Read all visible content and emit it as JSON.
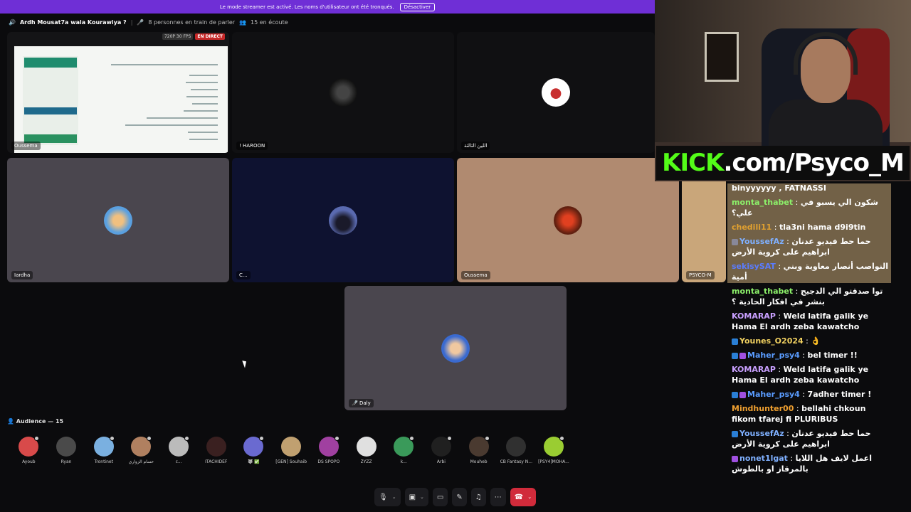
{
  "banner": {
    "text": "Le mode streamer est activé. Les noms d'utilisateur ont été tronqués.",
    "button": "Désactiver"
  },
  "header": {
    "channel": "Ardh Mousat7a wala Kourawiya ?",
    "speaking": "8 personnes en train de parler",
    "listening": "15 en écoute"
  },
  "share": {
    "name": "Oussema",
    "resolution": "720P 30 FPS",
    "live": "EN DIRECT"
  },
  "tiles": {
    "haroon": "! HAROON",
    "arabic1": "اللين الثالثة",
    "iardha": "Iardha",
    "c": "C...",
    "oussema": "Oussema",
    "psyco": "PSYCO-M",
    "daly": "Daly"
  },
  "kick": {
    "brand": "KICK",
    "rest": ".com/Psyco_M"
  },
  "chat": [
    {
      "user": "",
      "text": "binyyyyyy , FATNASSI",
      "color": "#fff",
      "rtl": false
    },
    {
      "user": "monta_thabet",
      "text": "شكون الي يسبو في علي؟",
      "color": "#8cf06a",
      "rtl": false
    },
    {
      "user": "chedili11",
      "text": "tla3ni hama d9i9tin",
      "color": "#e0a030",
      "rtl": false
    },
    {
      "user": "YoussefAz",
      "text": "حما حط فيديو عدنان ابراهيم على كروية الأرض",
      "color": "#7fb0ff",
      "rtl": false,
      "badge": "#889"
    },
    {
      "user": "sekisySAT",
      "text": "النواصب أنصار معاوية وبني أمية",
      "color": "#5a7cff",
      "rtl": false
    },
    {
      "user": "monta_thabet",
      "text": "توا صدقتو الي الدجيج بنشر في افكار الحادية ؟",
      "color": "#8cf06a",
      "rtl": false
    },
    {
      "user": "KOMARAP",
      "text": "Weld latifa galik ye Hama El ardh zeba kawatcho",
      "color": "#c9a0ff",
      "rtl": false
    },
    {
      "user": "Younes_O2024",
      "text": "👌",
      "color": "#f0d060",
      "rtl": false,
      "badge": "#2a7fd6"
    },
    {
      "user": "Maher_psy4",
      "text": "bel timer !!",
      "color": "#5a9cff",
      "rtl": false,
      "badge": "#2a7fd6",
      "badge2": "#a050e0"
    },
    {
      "user": "KOMARAP",
      "text": "Weld latifa galik ye Hama El ardh zeba kawatcho",
      "color": "#c9a0ff",
      "rtl": false
    },
    {
      "user": "Maher_psy4",
      "text": "7adher timer !",
      "color": "#5a9cff",
      "rtl": false,
      "badge": "#2a7fd6",
      "badge2": "#a050e0"
    },
    {
      "user": "Mindhunter00",
      "text": "bellahi chkoun fikom tfarej fi PLURIBUS",
      "color": "#f0a030",
      "rtl": false
    },
    {
      "user": "YoussefAz",
      "text": "حما حط فيديو عدنان ابراهيم على كروية الأرض",
      "color": "#7fb0ff",
      "rtl": false,
      "badge": "#2a7fd6"
    },
    {
      "user": "nonet1lgat",
      "text": "اعمل لايف هل اللايا بالمرقاز او بالطوش",
      "color": "#7fb0ff",
      "rtl": false,
      "badge": "#a050e0"
    }
  ],
  "audience": {
    "header": "Audience — 15",
    "members": [
      {
        "name": "Ayoub",
        "color": "#d84a4a"
      },
      {
        "name": "Ryan",
        "color": "#4a4a4a"
      },
      {
        "name": "Trontinet",
        "color": "#7ab0e0"
      },
      {
        "name": "حسام الزواري",
        "color": "#b08060"
      },
      {
        "name": "c...",
        "color": "#bbbbbb"
      },
      {
        "name": "ITACHIDEF",
        "color": "#3a2020"
      },
      {
        "name": "🐺 ✅",
        "color": "#6a6ad0"
      },
      {
        "name": "[GEN] Souhaib",
        "color": "#c0a070"
      },
      {
        "name": "DS SPOPO",
        "color": "#a040a0"
      },
      {
        "name": "ZYZZ",
        "color": "#e0e0e0"
      },
      {
        "name": "k...",
        "color": "#3a9a5a"
      },
      {
        "name": "Arbi",
        "color": "#202020"
      },
      {
        "name": "Mouheb",
        "color": "#4a3a30"
      },
      {
        "name": "CB Fantasy N...",
        "color": "#303030"
      },
      {
        "name": "[PSY4]MOHA...",
        "color": "#9acd32"
      }
    ]
  },
  "controls": {
    "mic": "mic-icon",
    "camera": "camera-off-icon",
    "share": "screen-share-icon",
    "activity": "activity-icon",
    "effects": "effects-icon",
    "more": "more-icon",
    "leave": "hangup-icon"
  }
}
